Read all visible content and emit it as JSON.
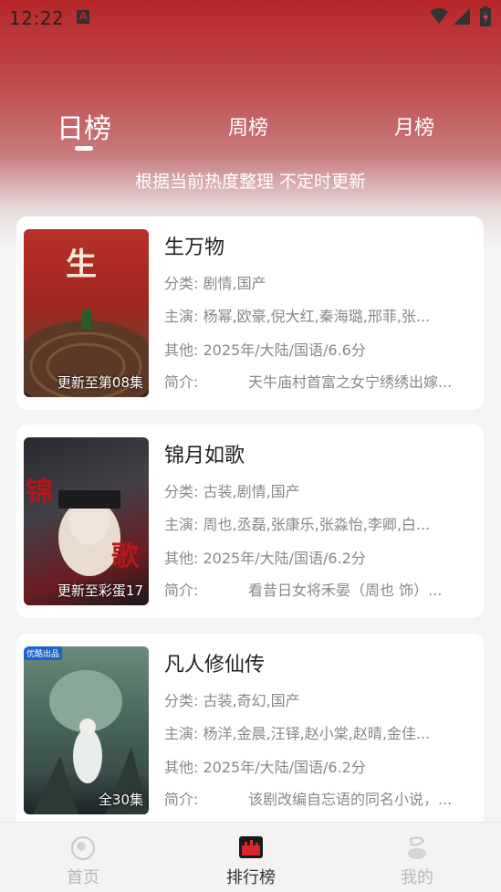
{
  "status": {
    "time": "12:22"
  },
  "tabs": [
    {
      "label": "日榜",
      "active": true
    },
    {
      "label": "周榜",
      "active": false
    },
    {
      "label": "月榜",
      "active": false
    }
  ],
  "subtitle": "根据当前热度整理 不定时更新",
  "items": [
    {
      "title": "生万物",
      "badge": "更新至第08集",
      "poster_colors": [
        "#a82520",
        "#5b2a1a"
      ],
      "category_label": "分类:",
      "category": "剧情,国产",
      "cast_label": "主演:",
      "cast": "杨幂,欧豪,倪大红,秦海璐,邢菲,张...",
      "other_label": "其他:",
      "other": "2025年/大陆/国语/6.6分",
      "intro_label": "简介:",
      "intro": "天牛庙村首富之女宁绣绣出嫁..."
    },
    {
      "title": "锦月如歌",
      "badge": "更新至彩蛋17",
      "poster_colors": [
        "#1c1c22",
        "#6b1b1f"
      ],
      "category_label": "分类:",
      "category": "古装,剧情,国产",
      "cast_label": "主演:",
      "cast": "周也,丞磊,张康乐,张淼怡,李卿,白...",
      "other_label": "其他:",
      "other": "2025年/大陆/国语/6.2分",
      "intro_label": "简介:",
      "intro": "看昔日女将禾晏（周也 饰）..."
    },
    {
      "title": "凡人修仙传",
      "badge": "全30集",
      "corner": "优酷出品",
      "poster_colors": [
        "#4f6a5a",
        "#24343a"
      ],
      "category_label": "分类:",
      "category": "古装,奇幻,国产",
      "cast_label": "主演:",
      "cast": "杨洋,金晨,汪铎,赵小棠,赵晴,金佳...",
      "other_label": "其他:",
      "other": "2025年/大陆/国语/6.2分",
      "intro_label": "简介:",
      "intro": "该剧改编自忘语的同名小说，..."
    }
  ],
  "bottom_nav": [
    {
      "label": "首页",
      "icon": "home-icon",
      "active": false
    },
    {
      "label": "排行榜",
      "icon": "ranking-icon",
      "active": true
    },
    {
      "label": "我的",
      "icon": "profile-icon",
      "active": false
    }
  ],
  "colors": {
    "brand": "#b8262a",
    "card_bg": "#ffffff",
    "text_muted": "#888888"
  }
}
